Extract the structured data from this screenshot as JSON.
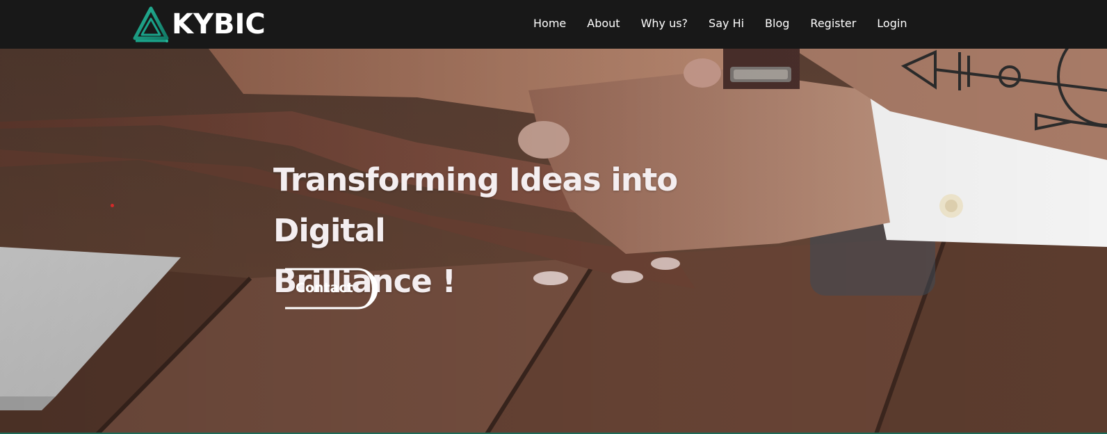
{
  "brand": {
    "name": "KYBIC",
    "logo_icon": "triangle-logo-icon",
    "accent": "#1aa38a"
  },
  "nav": {
    "items": [
      {
        "label": "Home"
      },
      {
        "label": "About"
      },
      {
        "label": "Why us?"
      },
      {
        "label": "Say Hi"
      },
      {
        "label": "Blog"
      },
      {
        "label": "Register"
      },
      {
        "label": "Login"
      }
    ],
    "background": "#181818",
    "text_color": "#ffffff"
  },
  "hero": {
    "title_line1": "Transforming Ideas into Digital",
    "title_line2": "Brilliance !",
    "cta_label": "Contact",
    "background_image": "teamwork-hands-on-wood-table"
  }
}
